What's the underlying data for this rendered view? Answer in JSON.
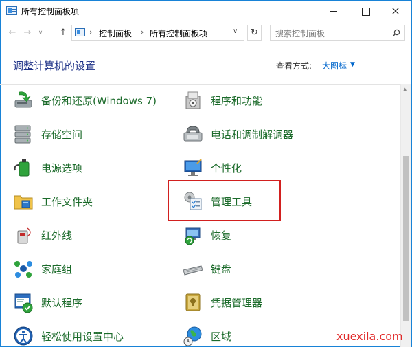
{
  "window": {
    "title": "所有控制面板项"
  },
  "address": {
    "crumbs": [
      "控制面板",
      "所有控制面板项"
    ],
    "search_placeholder": "搜索控制面板"
  },
  "header": {
    "title": "调整计算机的设置",
    "view_by_label": "查看方式:",
    "view_by_value": "大图标"
  },
  "items": [
    {
      "label": "备份和还原(Windows 7)",
      "icon": "backup-restore-icon"
    },
    {
      "label": "程序和功能",
      "icon": "programs-features-icon"
    },
    {
      "label": "存储空间",
      "icon": "storage-spaces-icon"
    },
    {
      "label": "电话和调制解调器",
      "icon": "phone-modem-icon"
    },
    {
      "label": "电源选项",
      "icon": "power-options-icon"
    },
    {
      "label": "个性化",
      "icon": "personalization-icon"
    },
    {
      "label": "工作文件夹",
      "icon": "work-folders-icon"
    },
    {
      "label": "管理工具",
      "icon": "administrative-tools-icon"
    },
    {
      "label": "红外线",
      "icon": "infrared-icon"
    },
    {
      "label": "恢复",
      "icon": "recovery-icon"
    },
    {
      "label": "家庭组",
      "icon": "homegroup-icon"
    },
    {
      "label": "键盘",
      "icon": "keyboard-icon"
    },
    {
      "label": "默认程序",
      "icon": "default-programs-icon"
    },
    {
      "label": "凭据管理器",
      "icon": "credential-manager-icon"
    },
    {
      "label": "轻松使用设置中心",
      "icon": "ease-of-access-icon"
    },
    {
      "label": "区域",
      "icon": "region-icon"
    }
  ],
  "watermark": "xuexila.com",
  "colors": {
    "link_green": "#1c6b2b",
    "title_blue": "#1e3287",
    "highlight_red": "#d2201f"
  }
}
